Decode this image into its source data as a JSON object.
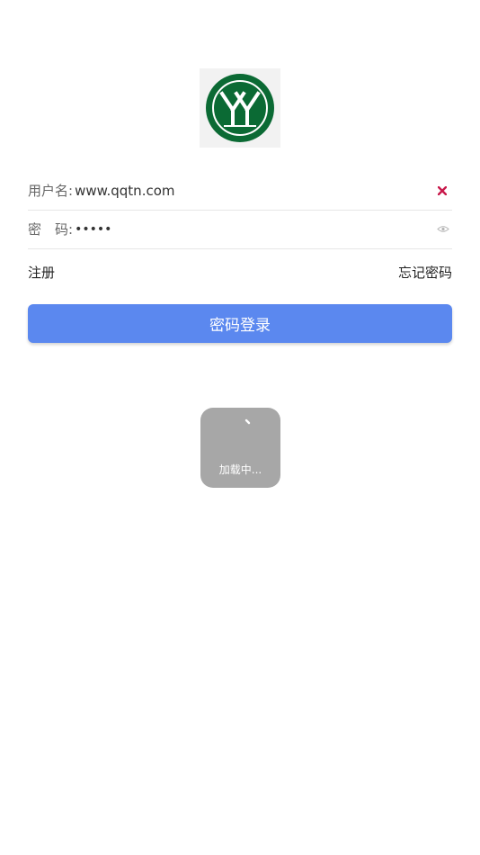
{
  "logo": {
    "icon": "school-logo-icon",
    "brand_color": "#0b6a34"
  },
  "form": {
    "username": {
      "label": "用户名:",
      "value": "www.qqtn.com",
      "clear_icon": "close-icon",
      "clear_color": "#c8184a"
    },
    "password": {
      "label": "密　码:",
      "value": "•••••",
      "toggle_icon": "eye-icon"
    }
  },
  "links": {
    "register": "注册",
    "forgot_password": "忘记密码"
  },
  "login_button": {
    "label": "密码登录",
    "color": "#5b88ef"
  },
  "loading": {
    "text": "加载中..."
  }
}
